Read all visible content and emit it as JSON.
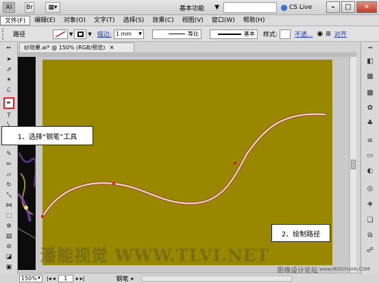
{
  "titlebar": {
    "logo": "Ai",
    "workspace_label": "基本功能",
    "cslive_label": "CS Live",
    "minimize": "–",
    "maximize": "□",
    "close": "✕"
  },
  "menu": [
    "文件(F)",
    "编辑(E)",
    "对象(O)",
    "文字(T)",
    "选择(S)",
    "效果(C)",
    "视图(V)",
    "窗口(W)",
    "帮助(H)"
  ],
  "controlbar": {
    "selection_label": "路径",
    "stroke_label": "描边:",
    "stroke_value": "1 mm",
    "profile_label": "等比",
    "brush_label": "基本",
    "style_label": "样式:",
    "opacity_link": "不透...",
    "align_link": "对齐"
  },
  "document": {
    "tab_title": "纱效果.ai* @ 150% (RGB/预览)",
    "tab_close": "×"
  },
  "statusbar": {
    "zoom": "150%",
    "page": "1",
    "tool_name": "钢笔"
  },
  "callouts": {
    "step1": "1、选择“钢笔”工具",
    "step2": "2、绘制路径"
  },
  "watermarks": {
    "main": "潘能视觉 WWW.TLVI.NET",
    "forum": "思缘设计论坛",
    "site": "www.MISSYUAN.COM"
  },
  "colors": {
    "artboard": "#9a8700",
    "path_stroke": "#f3e9e6",
    "path_edge": "#b0411f",
    "anchor": "#d62222",
    "tool_highlight": "#e02020"
  }
}
